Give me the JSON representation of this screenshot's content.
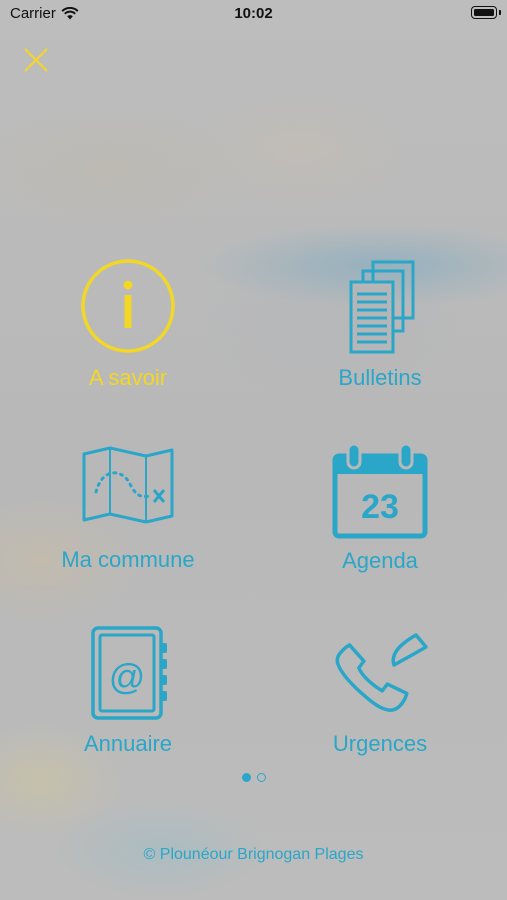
{
  "status_bar": {
    "carrier": "Carrier",
    "time": "10:02"
  },
  "menu": {
    "items": [
      {
        "label": "A savoir",
        "icon": "info-icon",
        "active": true
      },
      {
        "label": "Bulletins",
        "icon": "documents-icon",
        "active": false
      },
      {
        "label": "Ma commune",
        "icon": "map-icon",
        "active": false
      },
      {
        "label": "Agenda",
        "icon": "calendar-icon",
        "active": false,
        "day": "23"
      },
      {
        "label": "Annuaire",
        "icon": "address-book-icon",
        "active": false,
        "glyph": "@"
      },
      {
        "label": "Urgences",
        "icon": "phone-icon",
        "active": false
      }
    ]
  },
  "pager": {
    "pages": 2,
    "current": 1
  },
  "footer": {
    "text": "© Plounéour Brignogan Plages"
  },
  "colors": {
    "accent_blue": "#2aa6c8",
    "active_yellow": "#f2d727",
    "background": "#b9b9b9"
  }
}
